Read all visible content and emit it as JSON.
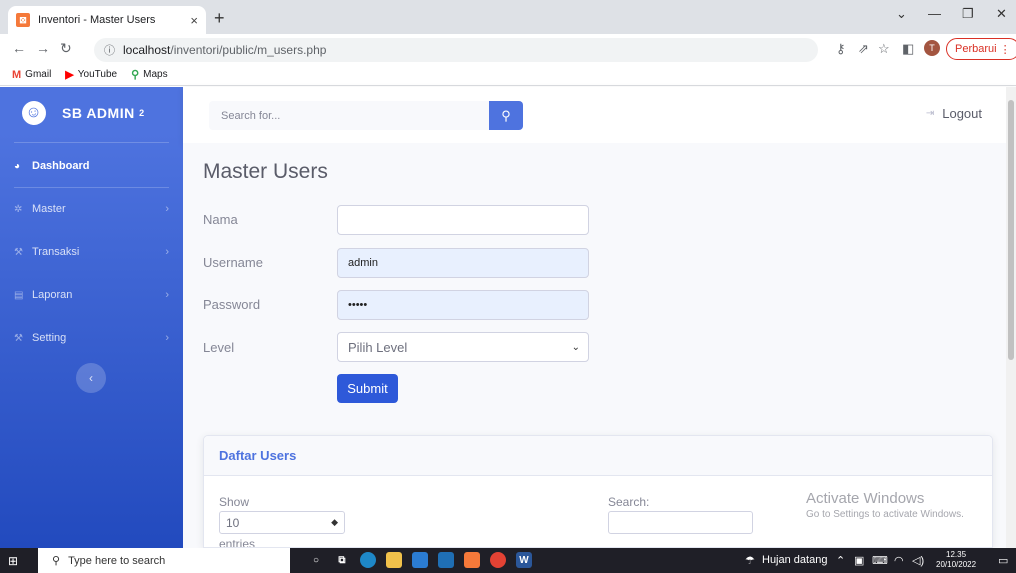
{
  "browser": {
    "tab_title": "Inventori - Master Users",
    "tab_close": "×",
    "new_tab": "+",
    "win_min": "—",
    "win_max": "❐",
    "win_close": "✕",
    "win_dropdown": "⌄",
    "url_host": "localhost",
    "url_path": "/inventori/public/m_users.php",
    "profile_initial": "T",
    "update_label": "Perbarui",
    "bookmarks": [
      {
        "label": "Gmail",
        "icon": "gmail-icon"
      },
      {
        "label": "YouTube",
        "icon": "youtube-icon"
      },
      {
        "label": "Maps",
        "icon": "maps-icon"
      }
    ]
  },
  "sidebar": {
    "brand": "SB ADMIN",
    "brand_sup": "2",
    "items": [
      {
        "label": "Dashboard",
        "icon": "tachometer-icon"
      },
      {
        "label": "Master",
        "icon": "cog-icon"
      },
      {
        "label": "Transaksi",
        "icon": "wrench-icon"
      },
      {
        "label": "Laporan",
        "icon": "table-icon"
      },
      {
        "label": "Setting",
        "icon": "wrench-icon"
      }
    ],
    "toggle_glyph": "‹"
  },
  "topbar": {
    "search_placeholder": "Search for...",
    "logout_label": "Logout"
  },
  "main": {
    "title": "Master Users",
    "form": {
      "nama_label": "Nama",
      "nama_value": "",
      "username_label": "Username",
      "username_value": "admin",
      "password_label": "Password",
      "password_value": "•••••",
      "level_label": "Level",
      "level_selected": "Pilih Level",
      "submit_label": "Submit"
    },
    "card": {
      "header": "Daftar Users",
      "show_label": "Show",
      "length_value": "10",
      "entries_label": "entries",
      "search_label": "Search:"
    }
  },
  "watermark": {
    "line1": "Activate Windows",
    "line2": "Go to Settings to activate Windows."
  },
  "taskbar": {
    "search_placeholder": "Type here to search",
    "weather": "Hujan datang",
    "time": "12.35",
    "date": "20/10/2022"
  },
  "colors": {
    "primary": "#4e73df",
    "sidebar_dark": "#224abe",
    "submit": "#2e59d9"
  }
}
